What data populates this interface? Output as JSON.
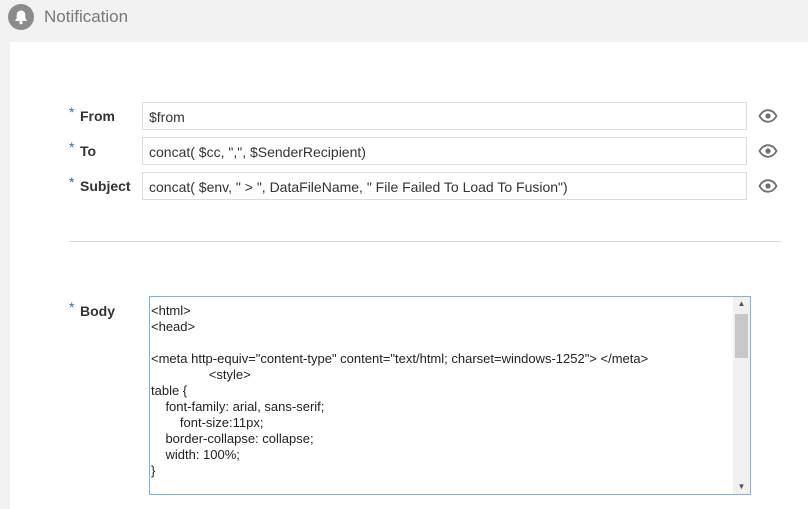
{
  "header": {
    "title": "Notification",
    "icon": "bell-icon"
  },
  "fields": {
    "from": {
      "label": "From",
      "required": "*",
      "value": "$from"
    },
    "to": {
      "label": "To",
      "required": "*",
      "value": "concat( $cc, \",\", $SenderRecipient)"
    },
    "subject": {
      "label": "Subject",
      "required": "*",
      "value": "concat( $env, \" > \", DataFileName, \" File Failed To Load To Fusion\")"
    }
  },
  "body": {
    "label": "Body",
    "required": "*",
    "value": "<html>\n<head>\n\n<meta http-equiv=\"content-type\" content=\"text/html; charset=windows-1252\"> </meta>\n                <style>\ntable {\n    font-family: arial, sans-serif;\n        font-size:11px;\n    border-collapse: collapse;\n    width: 100%;\n}"
  },
  "colors": {
    "accent": "#2e6ea8",
    "focus_border": "#7fb2e5",
    "icon_gray": "#8b8b8b"
  }
}
